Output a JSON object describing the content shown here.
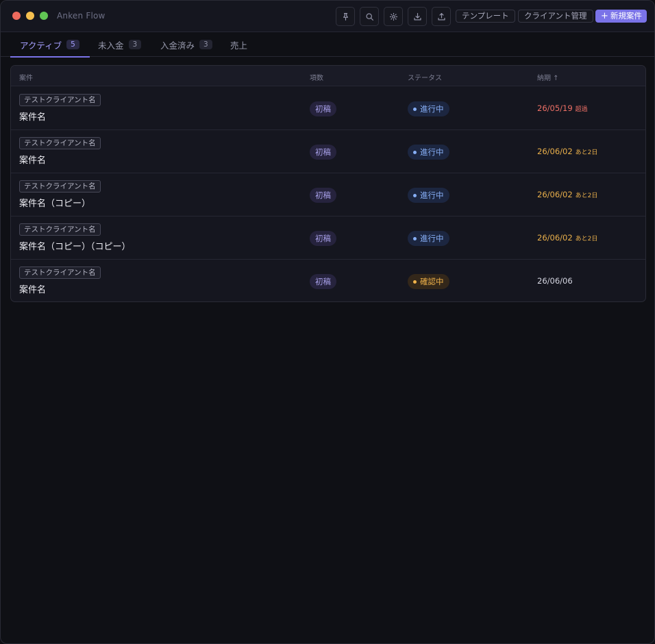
{
  "app": {
    "title": "Anken Flow"
  },
  "toolbar": {
    "template_label": "テンプレート",
    "client_mgmt_label": "クライアント管理",
    "new_case_label": "新規案件",
    "new_case_icon": "plus-icon"
  },
  "tabs": [
    {
      "label": "アクティブ",
      "count": "5"
    },
    {
      "label": "未入金",
      "count": "3"
    },
    {
      "label": "入金済み",
      "count": "3"
    },
    {
      "label": "売上",
      "count": ""
    }
  ],
  "table": {
    "headers": {
      "case": "案件",
      "phase": "項数",
      "status": "ステータス",
      "deadline": "納期 ↑"
    },
    "rows": [
      {
        "client": "テストクライアント名",
        "name": "案件名",
        "phase": "初稿",
        "status": "進行中",
        "status_kind": "progress",
        "deadline": "26/05/19",
        "deadline_note": "超過",
        "deadline_color": "#ee7066"
      },
      {
        "client": "テストクライアント名",
        "name": "案件名",
        "phase": "初稿",
        "status": "進行中",
        "status_kind": "progress",
        "deadline": "26/06/02",
        "deadline_note": "あと2日",
        "deadline_color": "#eab04b"
      },
      {
        "client": "テストクライアント名",
        "name": "案件名（コピー）",
        "phase": "初稿",
        "status": "進行中",
        "status_kind": "progress",
        "deadline": "26/06/02",
        "deadline_note": "あと2日",
        "deadline_color": "#eab04b"
      },
      {
        "client": "テストクライアント名",
        "name": "案件名（コピー）（コピー）",
        "phase": "初稿",
        "status": "進行中",
        "status_kind": "progress",
        "deadline": "26/06/02",
        "deadline_note": "あと2日",
        "deadline_color": "#eab04b"
      },
      {
        "client": "テストクライアント名",
        "name": "案件名",
        "phase": "初稿",
        "status": "確認中",
        "status_kind": "review",
        "deadline": "26/06/06",
        "deadline_note": "",
        "deadline_color": "#d6d7e2"
      }
    ]
  },
  "colors": {
    "accent": "#7a73e8",
    "overdue": "#ee7066",
    "soon": "#eab04b"
  }
}
